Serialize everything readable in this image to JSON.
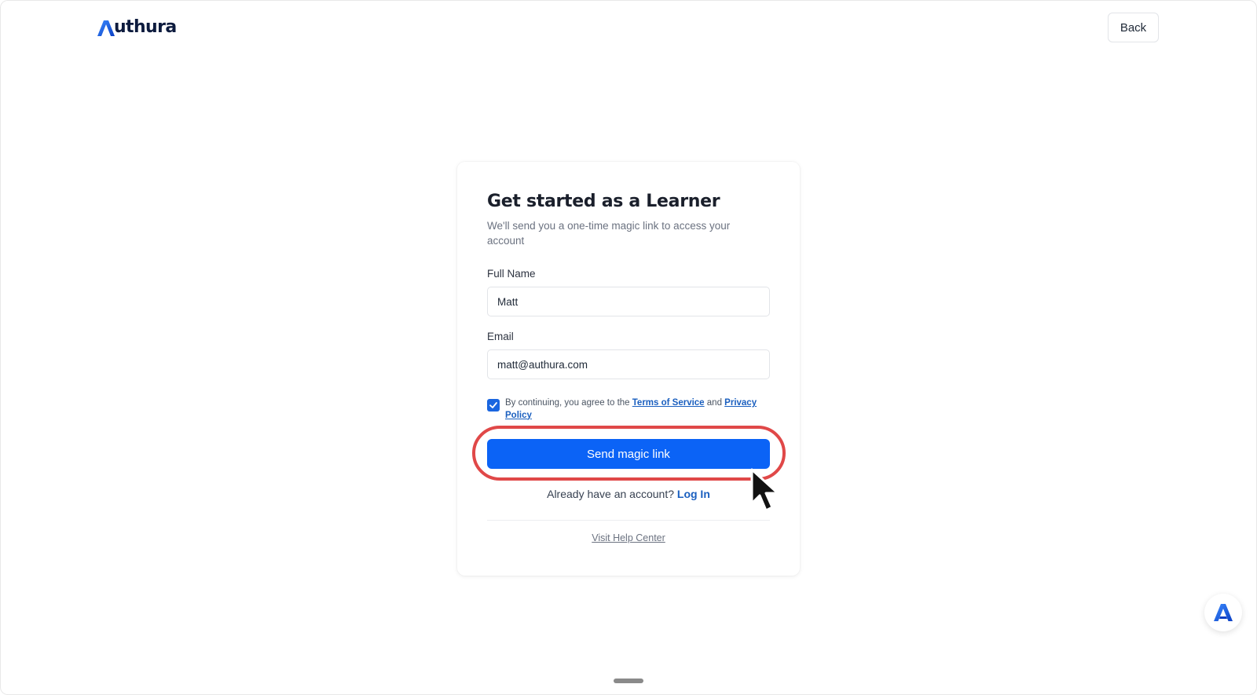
{
  "header": {
    "logo_text": "uthura",
    "logo_full": "Authura",
    "back_label": "Back"
  },
  "card": {
    "title": "Get started as a Learner",
    "subtitle": "We'll send you a one-time magic link to access your account",
    "full_name": {
      "label": "Full Name",
      "value": "Matt"
    },
    "email": {
      "label": "Email",
      "value": "matt@authura.com"
    },
    "consent": {
      "checked": true,
      "prefix": "By continuing, you agree to the ",
      "terms_label": "Terms of Service",
      "and": " and ",
      "privacy_label": "Privacy Policy"
    },
    "submit_label": "Send magic link",
    "login_prompt": "Already have an account? ",
    "login_link": "Log In",
    "help_link": "Visit Help Center"
  },
  "colors": {
    "primary": "#0b63f6",
    "link": "#1a5fbf",
    "highlight": "#e04848",
    "brand_dark": "#0d1b3e"
  },
  "icons": {
    "logo": "authura-a-icon",
    "checkbox": "check-icon",
    "cursor": "mouse-pointer-icon",
    "fab": "authura-chat-icon"
  }
}
